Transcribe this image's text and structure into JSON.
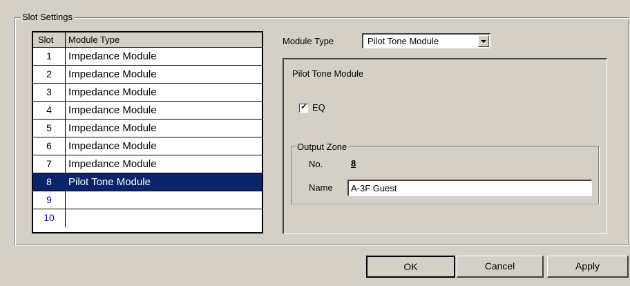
{
  "group": {
    "title": "Slot Settings"
  },
  "table": {
    "headers": {
      "slot": "Slot",
      "type": "Module Type"
    },
    "rows": [
      {
        "slot": "1",
        "type": "Impedance Module"
      },
      {
        "slot": "2",
        "type": "Impedance Module"
      },
      {
        "slot": "3",
        "type": "Impedance Module"
      },
      {
        "slot": "4",
        "type": "Impedance Module"
      },
      {
        "slot": "5",
        "type": "Impedance Module"
      },
      {
        "slot": "6",
        "type": "Impedance Module"
      },
      {
        "slot": "7",
        "type": "Impedance Module"
      },
      {
        "slot": "8",
        "type": "Pilot Tone Module"
      },
      {
        "slot": "9",
        "type": ""
      },
      {
        "slot": "10",
        "type": ""
      }
    ],
    "selected_row": 8
  },
  "module_type": {
    "label": "Module Type",
    "value": "Pilot Tone Module"
  },
  "panel": {
    "title": "Pilot Tone Module",
    "eq": {
      "label": "EQ",
      "checked": true
    },
    "output_zone": {
      "title": "Output Zone",
      "no_label": "No.",
      "no_value": "8",
      "name_label": "Name",
      "name_value": "A-3F Guest"
    }
  },
  "buttons": {
    "ok": "OK",
    "cancel": "Cancel",
    "apply": "Apply"
  },
  "icons": {
    "combo_arrow": "chevron-down-icon",
    "check": "checkmark-icon"
  },
  "colors": {
    "selection": "#0a246a",
    "face": "#d4d0c8",
    "empty_slot_text": "#0000c0"
  }
}
